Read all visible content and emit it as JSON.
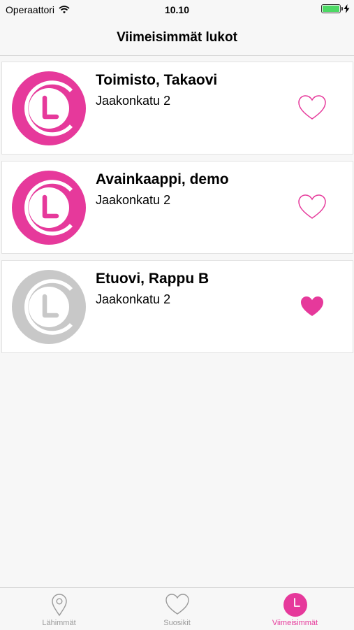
{
  "status": {
    "carrier": "Operaattori",
    "time": "10.10"
  },
  "nav": {
    "title": "Viimeisimmät lukot"
  },
  "locks": [
    {
      "title": "Toimisto, Takaovi",
      "address": "Jaakonkatu 2",
      "active": true,
      "favorite": false
    },
    {
      "title": "Avainkaappi, demo",
      "address": "Jaakonkatu 2",
      "active": true,
      "favorite": false
    },
    {
      "title": "Etuovi, Rappu B",
      "address": "Jaakonkatu 2",
      "active": false,
      "favorite": true
    }
  ],
  "tabs": [
    {
      "label": "Lähimmät",
      "icon": "location-pin-icon",
      "active": false
    },
    {
      "label": "Suosikit",
      "icon": "heart-icon",
      "active": false
    },
    {
      "label": "Viimeisimmät",
      "icon": "clock-icon",
      "active": true
    }
  ],
  "colors": {
    "accent": "#e6399b",
    "inactive_logo": "#c8c8c8",
    "tab_inactive": "#9a9a9a"
  }
}
